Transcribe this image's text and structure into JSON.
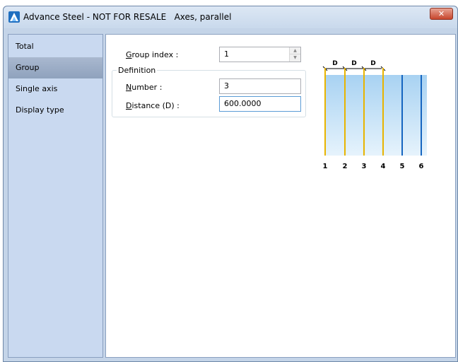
{
  "window": {
    "title": "Advance Steel - NOT FOR RESALE   Axes, parallel",
    "close_label": "✕"
  },
  "sidebar": {
    "items": [
      {
        "label": "Total",
        "active": false
      },
      {
        "label": "Group",
        "active": true
      },
      {
        "label": "Single axis",
        "active": false
      },
      {
        "label": "Display type",
        "active": false
      }
    ]
  },
  "form": {
    "group_index": {
      "label_first": "G",
      "label_rest": "roup index :",
      "value": "1"
    },
    "definition_title": "Definition",
    "number": {
      "label_first": "N",
      "label_rest": "umber :",
      "value": "3"
    },
    "distance": {
      "label_first": "D",
      "label_rest": "istance (D) :",
      "value": "600.0000"
    }
  },
  "diagram": {
    "dimension_labels": [
      "D",
      "D",
      "D"
    ],
    "axis_labels": [
      "1",
      "2",
      "3",
      "4",
      "5",
      "6"
    ],
    "colors": {
      "yellow_axis": "#e8b400",
      "blue_axis": "#1565c0",
      "band": "#a8d2f2"
    }
  }
}
